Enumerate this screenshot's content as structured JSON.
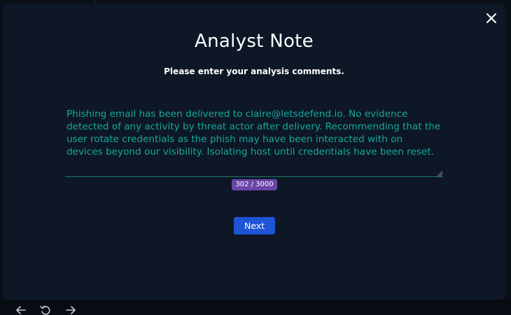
{
  "modal": {
    "title": "Analyst Note",
    "subtitle": "Please enter your analysis comments.",
    "note_text": "Phishing email has been delivered to claire@letsdefend.io. No evidence detected of any activity by threat actor after delivery. Recommending that the user rotate credentials as the phish may have been interacted with on devices beyond our visibility. Isolating host until credentials have been reset.",
    "char_counter": "302 / 3000",
    "next_label": "Next",
    "close_icon": "close-icon"
  },
  "bottom_nav": {
    "icons": [
      "arrow-left-icon",
      "reload-icon",
      "arrow-right-icon"
    ]
  },
  "colors": {
    "modal_bg": "#0d1726",
    "note_text": "#17a89a",
    "counter_badge": "#6a45a8",
    "next_button": "#1e55d6"
  }
}
